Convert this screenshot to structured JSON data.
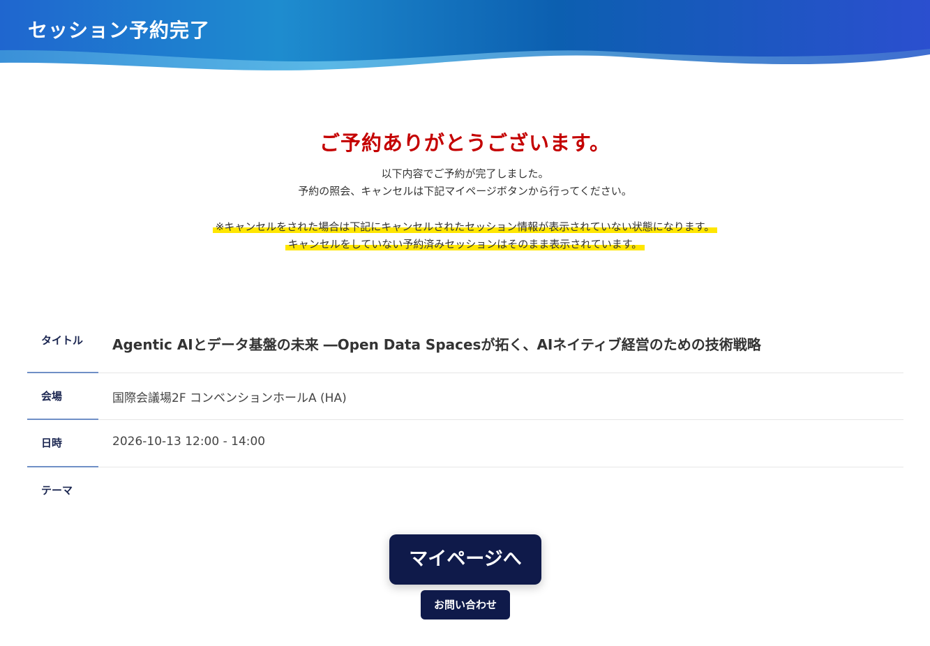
{
  "header": {
    "title": "セッション予約完了"
  },
  "message": {
    "thanks": "ご予約ありがとうございます。",
    "intro_line1": "以下内容でご予約が完了しました。",
    "intro_line2": "予約の照会、キャンセルは下記マイページボタンから行ってください。",
    "notice_line1": "※キャンセルをされた場合は下記にキャンセルされたセッション情報が表示されていない状態になります。",
    "notice_line2": "キャンセルをしていない予約済みセッションはそのまま表示されています。"
  },
  "session": {
    "title_label": "タイトル",
    "title_value": "Agentic AIとデータ基盤の未来 ―Open Data Spacesが拓く、AIネイティブ経営のための技術戦略",
    "venue_label": "会場",
    "venue_value": "国際会議場2F コンベンションホールA (HA)",
    "datetime_label": "日時",
    "datetime_value": "2026-10-13 12:00 - 14:00",
    "theme_label": "テーマ",
    "theme_value": ""
  },
  "buttons": {
    "mypage": "マイページへ",
    "contact": "お問い合わせ"
  },
  "colors": {
    "header_gradient_start": "#1a5fc8",
    "header_gradient_end": "#2b4fc9",
    "thanks_red": "#c40000",
    "highlight": "#ffe600",
    "button_navy": "#0f1a4a",
    "label_underline": "#6f8fc6"
  }
}
